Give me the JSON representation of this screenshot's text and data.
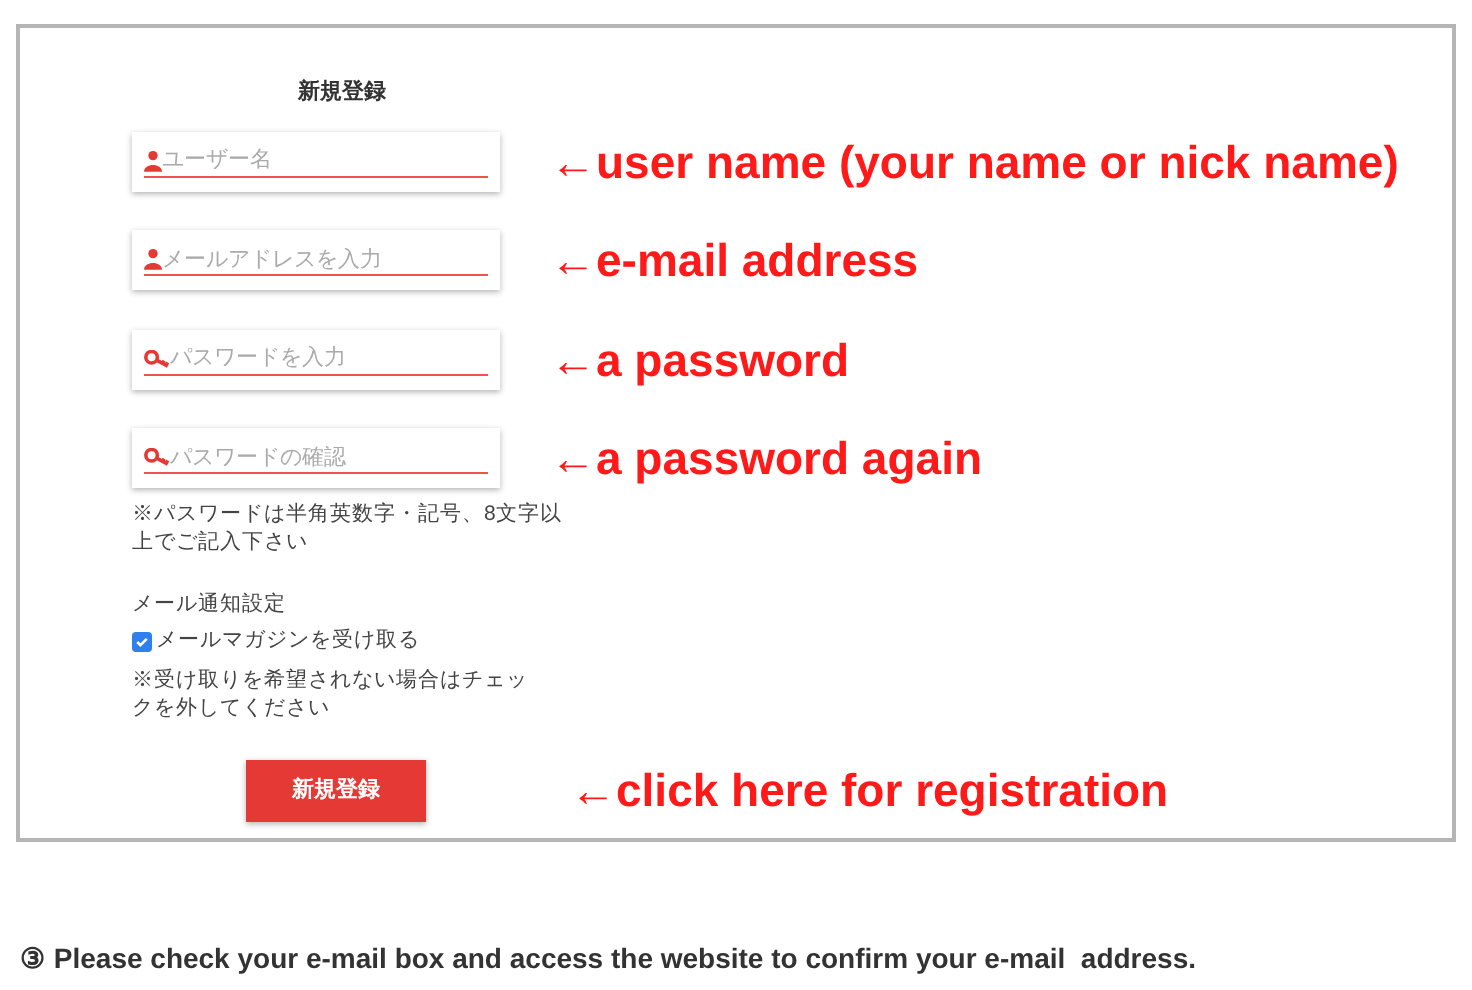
{
  "form": {
    "title": "新規登録",
    "fields": [
      {
        "kind": "user",
        "placeholder": "ユーザー名",
        "annotation": "←user name (your name or nick name)"
      },
      {
        "kind": "user",
        "placeholder": "メールアドレスを入力",
        "annotation": "←e-mail address"
      },
      {
        "kind": "key",
        "placeholder": "パスワードを入力",
        "annotation": "←a password"
      },
      {
        "kind": "key",
        "placeholder": "パスワードの確認",
        "annotation": "←a password again"
      }
    ],
    "password_note": "※パスワードは半角英数字・記号、8文字以上でご記入下さい",
    "notification_heading": "メール通知設定",
    "newsletter": {
      "label": "メールマガジンを受け取る",
      "checked": true
    },
    "newsletter_note": "※受け取りを希望されない場合はチェックを外してください",
    "submit": {
      "label": "新規登録",
      "annotation": "←click here for registration"
    }
  },
  "step_text": "③ Please check your e-mail box and access the website to confirm your e-mail  address."
}
